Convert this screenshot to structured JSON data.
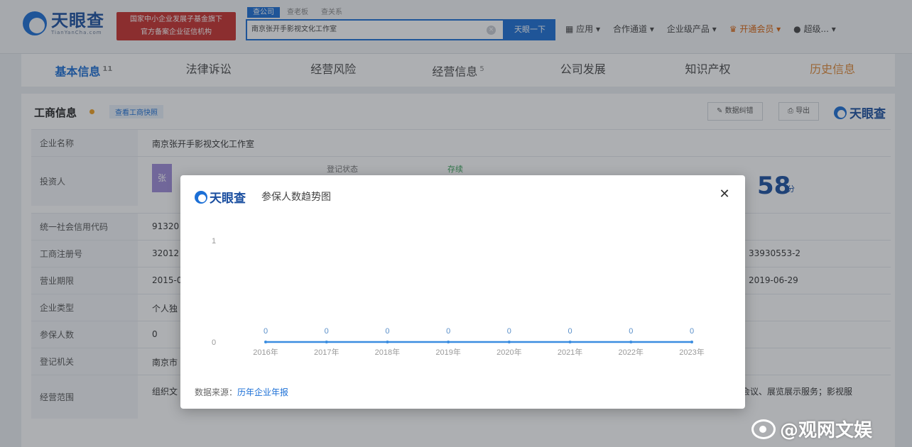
{
  "header": {
    "logo_text": "天眼查",
    "logo_sub": "TianYanCha.com",
    "promo_line1": "国家中小企业发展子基金旗下",
    "promo_line2": "官方备案企业征信机构",
    "search_tabs": [
      "查公司",
      "查老板",
      "查关系"
    ],
    "search_value": "南京张开手影视文化工作室",
    "search_button": "天眼一下",
    "nav": {
      "apps": "应用",
      "cooperation": "合作通道",
      "enterprise": "企业级产品",
      "vip": "开通会员",
      "user": "超级..."
    }
  },
  "secondary_nav": [
    {
      "label": "基本信息",
      "count": "11"
    },
    {
      "label": "法律诉讼",
      "count": ""
    },
    {
      "label": "经营风险",
      "count": ""
    },
    {
      "label": "经营信息",
      "count": "5"
    },
    {
      "label": "公司发展",
      "count": ""
    },
    {
      "label": "知识产权",
      "count": ""
    },
    {
      "label": "历史信息",
      "count": ""
    }
  ],
  "business_info": {
    "title": "工商信息",
    "snapshot_link": "查看工商快照",
    "data_correction": "数据纠错",
    "export": "导出",
    "watermark_logo": "天眼查",
    "rows": {
      "company_name_label": "企业名称",
      "company_name_value": "南京张开手影视文化工作室",
      "investor_label": "投资人",
      "investor_avatar": "张",
      "reg_status_label": "登记状态",
      "reg_status_value": "存续",
      "score": "58",
      "score_unit": "分",
      "credit_code_label": "统一社会信用代码",
      "credit_code_value": "91320",
      "reg_no_label": "工商注册号",
      "reg_no_value": "32012",
      "reg_no_right": "33930553-2",
      "term_label": "营业期限",
      "term_value": "2015-0",
      "term_right": "2019-06-29",
      "type_label": "企业类型",
      "type_value": "个人独",
      "insured_label": "参保人数",
      "insured_value": "0",
      "authority_label": "登记机关",
      "authority_value": "南京市",
      "scope_label": "经营范围",
      "scope_value": "组织文",
      "scope_right": "会议、展览展示服务；影视服"
    }
  },
  "modal": {
    "logo_text": "天眼查",
    "title": "参保人数趋势图",
    "close_icon": "close-icon",
    "source_label": "数据来源：",
    "source_link": "历年企业年报"
  },
  "chart_data": {
    "type": "line",
    "title": "参保人数趋势图",
    "categories": [
      "2016年",
      "2017年",
      "2018年",
      "2019年",
      "2020年",
      "2021年",
      "2022年",
      "2023年"
    ],
    "values": [
      0,
      0,
      0,
      0,
      0,
      0,
      0,
      0
    ],
    "ylim": [
      0,
      1
    ],
    "yticks": [
      "0",
      "1"
    ],
    "data_labels": [
      "0",
      "0",
      "0",
      "0",
      "0",
      "0",
      "0",
      "0"
    ],
    "color": "#3b8de0",
    "grid": false
  },
  "watermark": {
    "text": "@观网文娱"
  }
}
